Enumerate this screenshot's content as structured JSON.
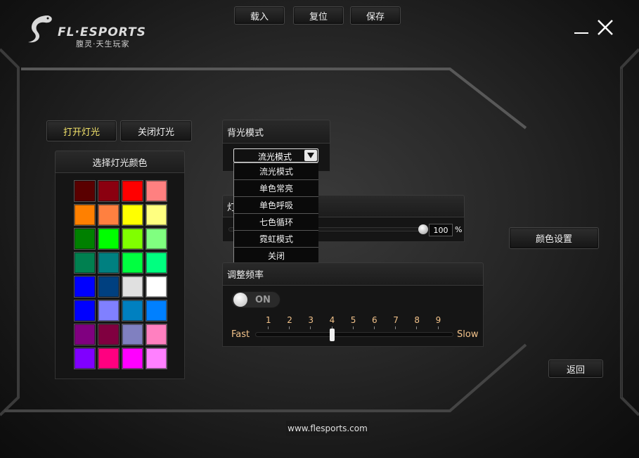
{
  "toolbar": {
    "load": "载入",
    "reset": "复位",
    "save": "保存"
  },
  "logo": {
    "brand": "FL·ESPORTS",
    "slogan": "腹灵·天生玩家"
  },
  "lighting": {
    "on": "打开灯光",
    "off": "关闭灯光"
  },
  "color_panel": {
    "title": "选择灯光颜色",
    "swatches": [
      "#5a0000",
      "#8b0010",
      "#ff0000",
      "#ff8080",
      "#ff8000",
      "#ff8040",
      "#ffff00",
      "#ffff80",
      "#008000",
      "#00ff00",
      "#80ff00",
      "#80ff80",
      "#008050",
      "#008080",
      "#00ff40",
      "#00ff80",
      "#0000ff",
      "#004080",
      "#e0e0e0",
      "#ffffff",
      "#0000ff",
      "#8080ff",
      "#0080c0",
      "#0080ff",
      "#800080",
      "#800040",
      "#8080c0",
      "#ff80c0",
      "#8000ff",
      "#ff0080",
      "#ff00ff",
      "#ff80ff"
    ]
  },
  "backlight": {
    "title": "背光模式",
    "selected": "流光模式",
    "options": [
      "流光模式",
      "单色常亮",
      "单色呼吸",
      "七色循环",
      "霓虹模式",
      "关闭"
    ]
  },
  "brightness": {
    "title_partial": "灯",
    "value": "100",
    "unit": "%",
    "level": 1.0
  },
  "frequency": {
    "title": "调整频率",
    "toggle": "ON",
    "ticks": [
      "1",
      "2",
      "3",
      "4",
      "5",
      "6",
      "7",
      "8",
      "9"
    ],
    "fast": "Fast",
    "slow": "Slow",
    "current": 4
  },
  "color_settings": "颜色设置",
  "back": "返回",
  "footer": "www.flesports.com"
}
